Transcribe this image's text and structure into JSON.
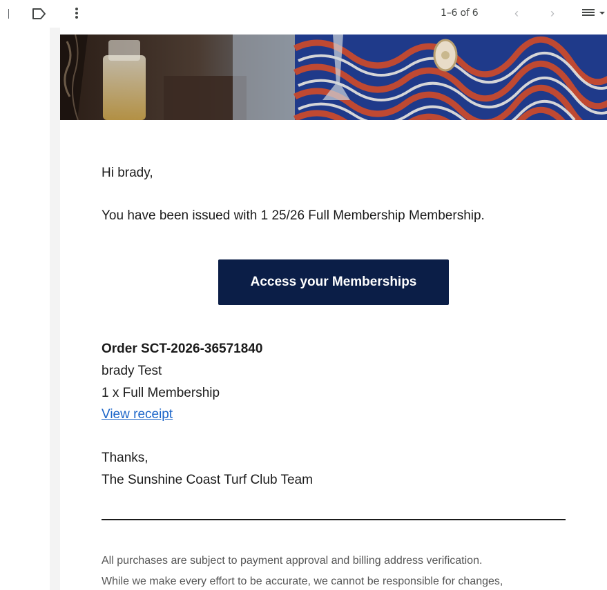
{
  "toolbar": {
    "label_icon": "label-icon",
    "more_icon": "more-vert-icon",
    "pagination_text": "1–6 of 6",
    "prev_icon": "chevron-left-icon",
    "next_icon": "chevron-right-icon",
    "density_icon": "density-icon",
    "prev_glyph": "‹",
    "next_glyph": "›"
  },
  "email": {
    "greeting": "Hi brady,",
    "issued_text": "You have been issued with 1 25/26 Full Membership Membership.",
    "cta_label": "Access your Memberships",
    "order": {
      "title": "Order SCT-2026-36571840",
      "name": "brady Test",
      "item": "1 x Full Membership",
      "receipt_link": "View receipt"
    },
    "signoff": "Thanks,",
    "team": "The Sunshine Coast Turf Club Team",
    "disclaimer_line1": "All purchases are subject to payment approval and billing address verification.",
    "disclaimer_line2": "While we make every effort to be accurate, we cannot be responsible for changes,"
  },
  "colors": {
    "cta_background": "#0b1e47",
    "link": "#1a64c8"
  }
}
